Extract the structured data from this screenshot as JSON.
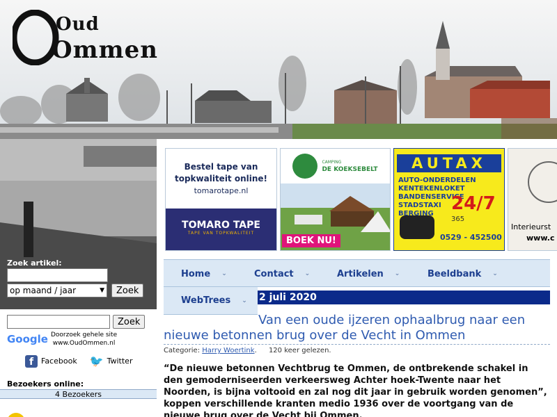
{
  "logo": {
    "line1": "Oud",
    "line2": "Ommen"
  },
  "ads": [
    {
      "line1": "Bestel tape van",
      "line2": "topkwaliteit online!",
      "line3": "tomarotape.nl",
      "brand": "TOMARO TAPE",
      "tagline": "TAPE VAN TOPKWALITEIT"
    },
    {
      "camp_small": "CAMPING",
      "camp_name": "DE KOEKSEBELT",
      "cta": "BOEK NU!"
    },
    {
      "brand": "AUTAX",
      "service1": "AUTO-ONDERDELEN",
      "service2": "KENTEKENLOKET",
      "service3": "BANDENSERVICE",
      "service4": "STADSTAXI",
      "service5": "BERGING",
      "badge": "24/7",
      "badge_sub": "365",
      "phone": "0529 - 452500"
    },
    {
      "text1": "Interieurst",
      "text2": "www.c"
    }
  ],
  "sidebar": {
    "search_label": "Zoek artikel:",
    "search_value": "",
    "period_select": "op maand / jaar",
    "zoek_button": "Zoek",
    "google_brand": "Google",
    "google_button": "Zoek",
    "google_text1": "Doorzoek gehele site",
    "google_text2": "www.OudOmmen.nl",
    "facebook": "Facebook",
    "twitter": "Twitter",
    "visitors_label": "Bezoekers online:",
    "visitors_count": "4 Bezoekers"
  },
  "nav": {
    "items": [
      "Home",
      "Contact",
      "Artikelen",
      "Beeldbank"
    ],
    "webtrees": "WebTrees"
  },
  "article": {
    "date": "2 juli 2020",
    "title_line1": "Van een oude ijzeren ophaalbrug naar een",
    "title_line2": "nieuwe betonnen brug over de Vecht in Ommen",
    "category_label": "Categorie:",
    "author": "Harry Woertink",
    "reads": "120 keer gelezen.",
    "body": "“De nieuwe betonnen Vechtbrug te Ommen, de ontbrekende schakel in den gemoderniseerden verkeersweg Achter hoek-Twente naar het Noorden, is bijna voltooid en zal nog dit jaar in gebruik worden genomen”, koppen verschillende kranten medio 1936 over de voortgang van de nieuwe brug over de Vecht bij Ommen."
  }
}
